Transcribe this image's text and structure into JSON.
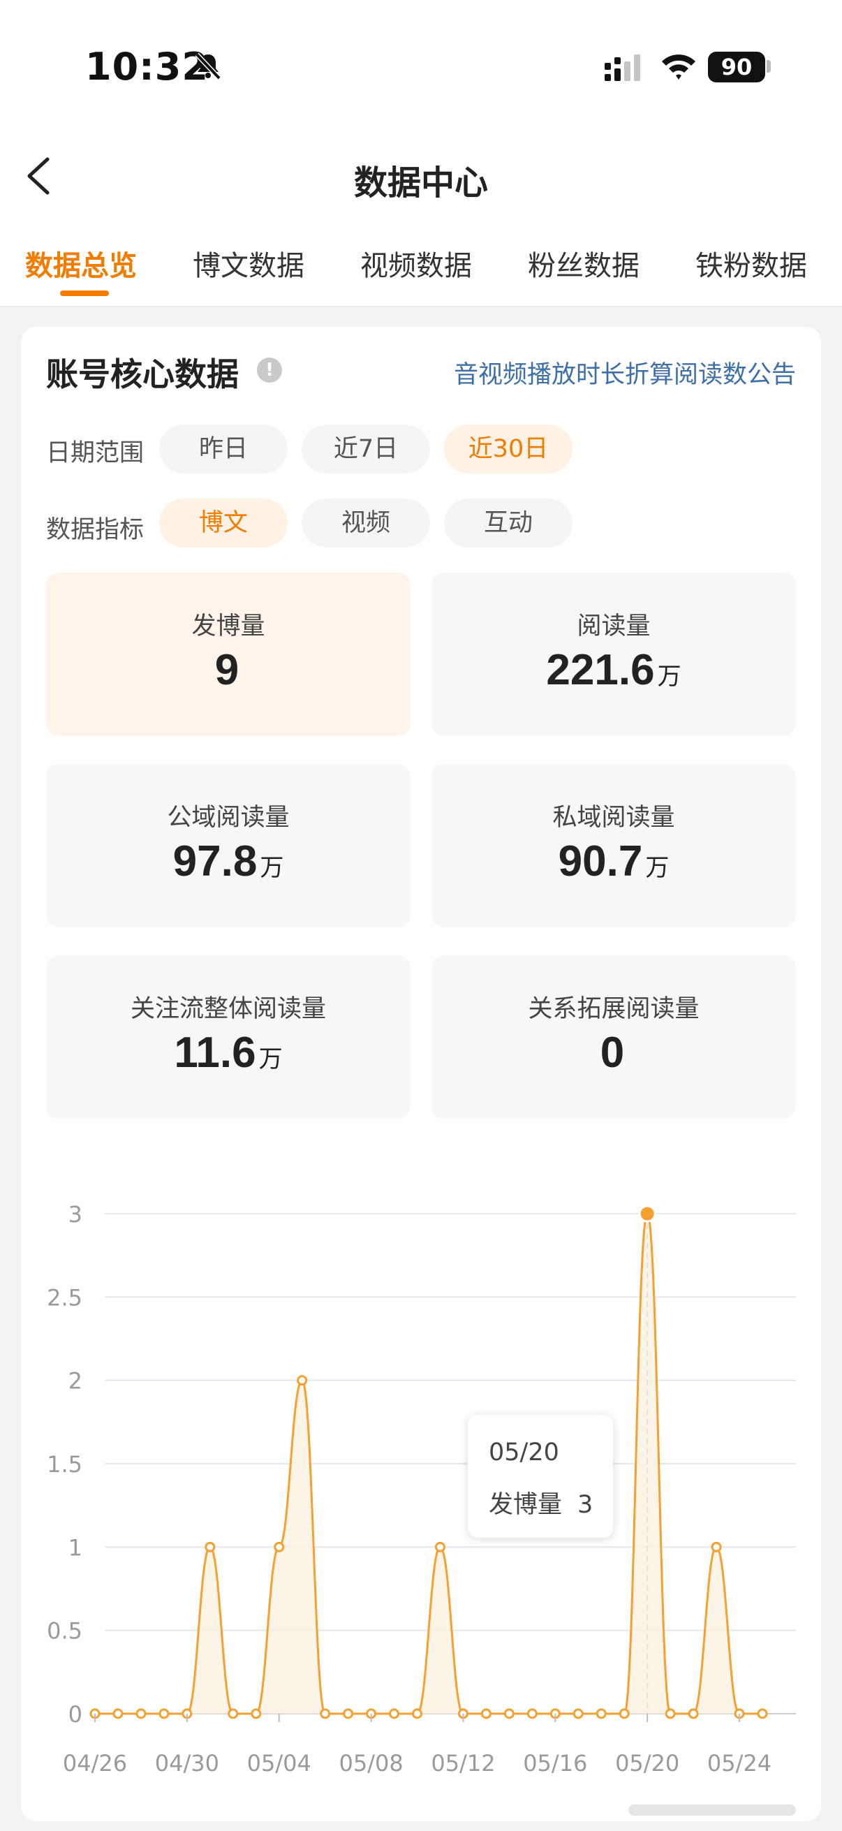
{
  "status_bar": {
    "time": "10:32",
    "battery": "90"
  },
  "header": {
    "title": "数据中心"
  },
  "tabs": [
    {
      "label": "数据总览",
      "active": true
    },
    {
      "label": "博文数据",
      "active": false
    },
    {
      "label": "视频数据",
      "active": false
    },
    {
      "label": "粉丝数据",
      "active": false
    },
    {
      "label": "铁粉数据",
      "active": false
    }
  ],
  "core": {
    "title": "账号核心数据",
    "info_glyph": "!",
    "notice_link": "音视频播放时长折算阅读数公告",
    "date_range_label": "日期范围",
    "date_options": [
      "昨日",
      "近7日",
      "近30日"
    ],
    "date_selected": "近30日",
    "metric_label": "数据指标",
    "metric_options": [
      "博文",
      "视频",
      "互动"
    ],
    "metric_selected": "博文"
  },
  "stats": [
    {
      "label": "发博量",
      "value": "9",
      "unit": ""
    },
    {
      "label": "阅读量",
      "value": "221.6",
      "unit": "万"
    },
    {
      "label": "公域阅读量",
      "value": "97.8",
      "unit": "万"
    },
    {
      "label": "私域阅读量",
      "value": "90.7",
      "unit": "万"
    },
    {
      "label": "关注流整体阅读量",
      "value": "11.6",
      "unit": "万"
    },
    {
      "label": "关系拓展阅读量",
      "value": "0",
      "unit": ""
    }
  ],
  "tooltip": {
    "date": "05/20",
    "series": "发博量",
    "value": "3"
  },
  "colors": {
    "accent": "#f07c00",
    "line": "#f5a030",
    "link": "#3e6fa8"
  },
  "chart_data": {
    "type": "line",
    "x": [
      "04/26",
      "04/27",
      "04/28",
      "04/29",
      "04/30",
      "05/01",
      "05/02",
      "05/03",
      "05/04",
      "05/05",
      "05/06",
      "05/07",
      "05/08",
      "05/09",
      "05/10",
      "05/11",
      "05/12",
      "05/13",
      "05/14",
      "05/15",
      "05/16",
      "05/17",
      "05/18",
      "05/19",
      "05/20",
      "05/21",
      "05/22",
      "05/23",
      "05/24",
      "05/25"
    ],
    "series": [
      {
        "name": "发博量",
        "values": [
          0,
          0,
          0,
          0,
          0,
          1,
          0,
          0,
          1,
          2,
          0,
          0,
          0,
          0,
          0,
          1,
          0,
          0,
          0,
          0,
          0,
          0,
          0,
          0,
          3,
          0,
          0,
          1,
          0,
          0
        ]
      }
    ],
    "x_tick_labels": [
      "04/26",
      "04/30",
      "05/04",
      "05/08",
      "05/12",
      "05/16",
      "05/20",
      "05/24"
    ],
    "y_tick_labels": [
      "0",
      "0.5",
      "1",
      "1.5",
      "2",
      "2.5",
      "3"
    ],
    "ylim": [
      0,
      3
    ],
    "grid": true,
    "highlight": "05/20"
  }
}
